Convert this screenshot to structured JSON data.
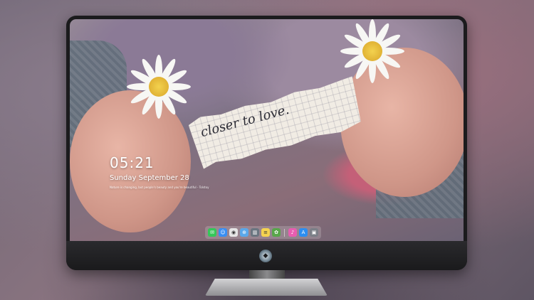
{
  "lockscreen": {
    "time": "05:21",
    "date": "Sunday September  28",
    "quote": "Nature is changing, but people's beauty and you're beautiful - Tolstoy",
    "note_text": "closer to love."
  },
  "dock": {
    "apps": [
      {
        "name": "messages",
        "color": "#35c759",
        "glyph": "✉"
      },
      {
        "name": "finder",
        "color": "#3a8ef2",
        "glyph": "☺"
      },
      {
        "name": "chrome",
        "color": "#e6e6e6",
        "glyph": "◉"
      },
      {
        "name": "safari",
        "color": "#5aa8ea",
        "glyph": "⊕"
      },
      {
        "name": "clapper",
        "color": "#6a7580",
        "glyph": "▥"
      },
      {
        "name": "notes",
        "color": "#f5d34f",
        "glyph": "≡"
      },
      {
        "name": "photos",
        "color": "#58a64a",
        "glyph": "✿"
      },
      {
        "name": "itunes",
        "color": "#e85db0",
        "glyph": "♪"
      },
      {
        "name": "appstore",
        "color": "#2d8ef0",
        "glyph": "A"
      },
      {
        "name": "screenshot",
        "color": "#7b7f87",
        "glyph": "▣"
      }
    ]
  }
}
